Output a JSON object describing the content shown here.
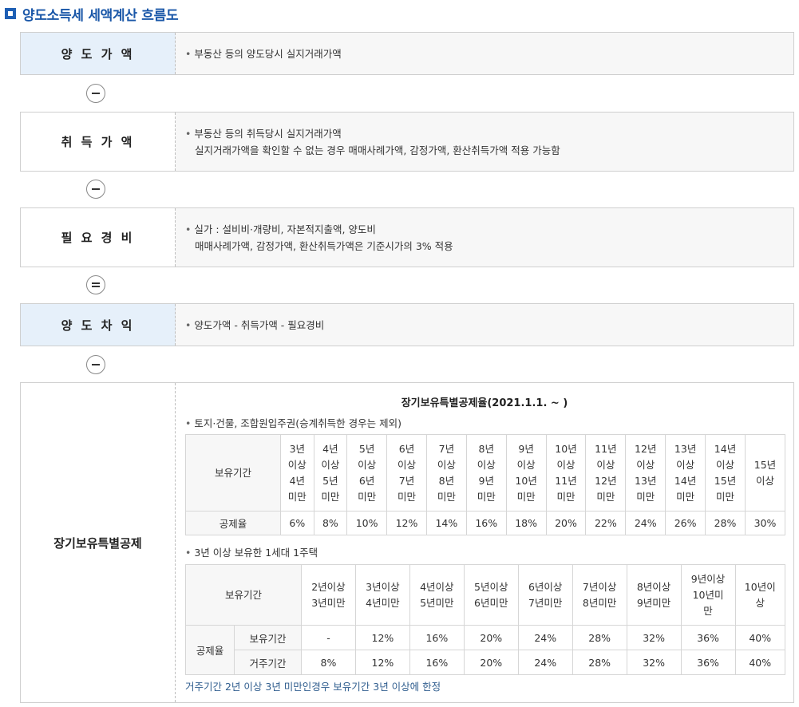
{
  "title": "양도소득세 세액계산 흐름도",
  "rows": [
    {
      "label": "양 도 가 액",
      "lines": [
        "부동산 등의 양도당시 실지거래가액"
      ]
    },
    {
      "label": "취 득 가 액",
      "lines": [
        "부동산 등의 취득당시 실지거래가액",
        "실지거래가액을 확인할 수 없는 경우 매매사례가액, 감정가액, 환산취득가액 적용 가능함"
      ]
    },
    {
      "label": "필 요 경 비",
      "lines": [
        "실가 : 설비비·개량비, 자본적지출액, 양도비",
        "매매사례가액, 감정가액, 환산취득가액은 기준시가의 3% 적용"
      ]
    },
    {
      "label": "양 도 차 익",
      "lines": [
        "양도가액 - 취득가액 - 필요경비"
      ]
    }
  ],
  "operators": [
    "minus",
    "minus",
    "equals",
    "minus"
  ],
  "deduction": {
    "label": "장기보유특별공제",
    "rate_title": "장기보유특별공제율(2021.1.1. ~ )",
    "section1": {
      "heading": "토지·건물, 조합원입주권(승계취득한 경우는 제외)",
      "period_header": "보유기간",
      "rate_header": "공제율",
      "periods": [
        [
          "3년",
          "이상",
          "4년",
          "미만"
        ],
        [
          "4년",
          "이상",
          "5년",
          "미만"
        ],
        [
          "5년",
          "이상",
          "6년",
          "미만"
        ],
        [
          "6년",
          "이상",
          "7년",
          "미만"
        ],
        [
          "7년",
          "이상",
          "8년",
          "미만"
        ],
        [
          "8년",
          "이상",
          "9년",
          "미만"
        ],
        [
          "9년",
          "이상",
          "10년",
          "미만"
        ],
        [
          "10년",
          "이상",
          "11년",
          "미만"
        ],
        [
          "11년",
          "이상",
          "12년",
          "미만"
        ],
        [
          "12년",
          "이상",
          "13년",
          "미만"
        ],
        [
          "13년",
          "이상",
          "14년",
          "미만"
        ],
        [
          "14년",
          "이상",
          "15년",
          "미만"
        ],
        [
          "15년",
          "이상"
        ]
      ],
      "rates": [
        "6%",
        "8%",
        "10%",
        "12%",
        "14%",
        "16%",
        "18%",
        "20%",
        "22%",
        "24%",
        "26%",
        "28%",
        "30%"
      ]
    },
    "section2": {
      "heading": "3년 이상 보유한 1세대 1주택",
      "period_header": "보유기간",
      "rate_header": "공제율",
      "periods": [
        [
          "2년이상",
          "3년미만"
        ],
        [
          "3년이상",
          "4년미만"
        ],
        [
          "4년이상",
          "5년미만"
        ],
        [
          "5년이상",
          "6년미만"
        ],
        [
          "6년이상",
          "7년미만"
        ],
        [
          "7년이상",
          "8년미만"
        ],
        [
          "8년이상",
          "9년미만"
        ],
        [
          "9년이상",
          "10년미",
          "만"
        ],
        [
          "10년이",
          "상"
        ]
      ],
      "holding_label": "보유기간",
      "holding_rates": [
        "-",
        "12%",
        "16%",
        "20%",
        "24%",
        "28%",
        "32%",
        "36%",
        "40%"
      ],
      "residence_label": "거주기간",
      "residence_rates": [
        "8%",
        "12%",
        "16%",
        "20%",
        "24%",
        "28%",
        "32%",
        "36%",
        "40%"
      ]
    },
    "note": "거주기간 2년 이상 3년 미만인경우 보유기간 3년 이상에 한정"
  }
}
